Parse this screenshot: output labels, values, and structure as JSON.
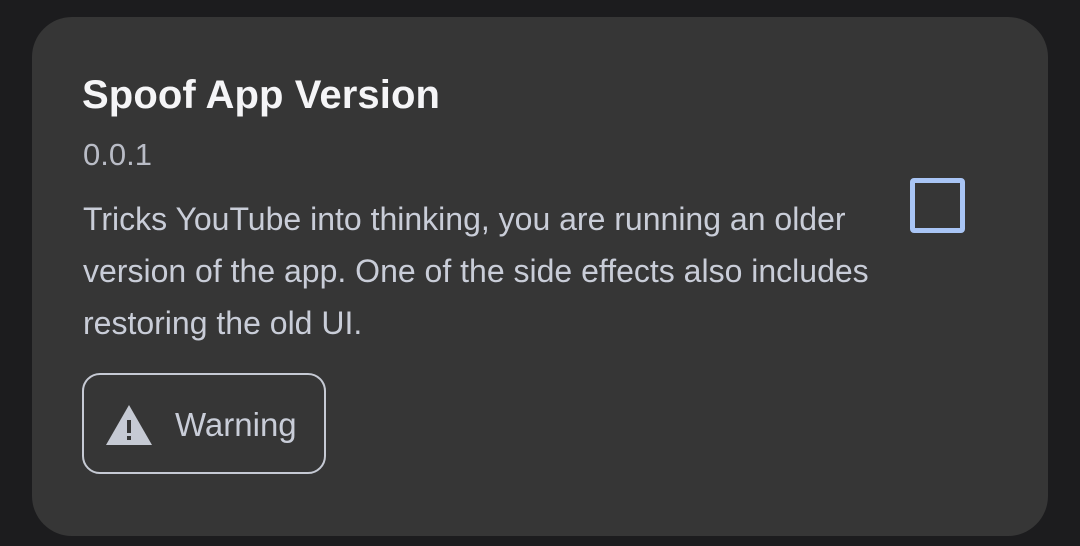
{
  "patch": {
    "title": "Spoof App Version",
    "version": "0.0.1",
    "description": "Tricks YouTube into thinking, you are running an older version of the app. One of the side effects also includes restoring the old UI.",
    "checked": false,
    "warning_chip": {
      "label": "Warning",
      "icon": "warning-triangle-icon"
    }
  },
  "colors": {
    "background": "#1c1c1e",
    "card": "#363636",
    "accent": "#a9c5f5",
    "text_primary": "#f5f5f7",
    "text_secondary": "#c9cdd8"
  }
}
